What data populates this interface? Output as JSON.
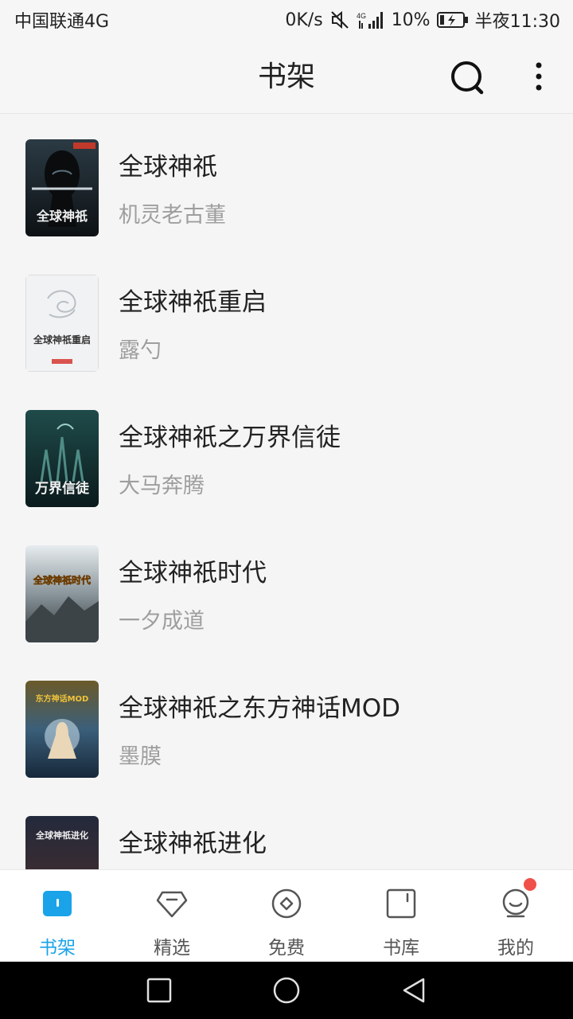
{
  "status_bar": {
    "carrier": "中国联通4G",
    "speed": "0K/s",
    "network": "4G",
    "battery": "10%",
    "time": "半夜11:30",
    "icons": [
      "mute-icon",
      "signal-icon",
      "battery-charging-icon"
    ]
  },
  "app_bar": {
    "title": "书架",
    "search_icon": "search-icon",
    "more_icon": "more-vertical-icon"
  },
  "books": [
    {
      "title": "全球神祇",
      "author": "机灵老古董",
      "cover_text": "全球神祇"
    },
    {
      "title": "全球神祇重启",
      "author": "露勺",
      "cover_text": "全球神祇重启"
    },
    {
      "title": "全球神祇之万界信徒",
      "author": "大马奔腾",
      "cover_text": "万界信徒"
    },
    {
      "title": "全球神祇时代",
      "author": "一夕成道",
      "cover_text": "全球神祇时代"
    },
    {
      "title": "全球神祇之东方神话MOD",
      "author": "墨膜",
      "cover_text": "东方神话MOD"
    },
    {
      "title": "全球神祇进化",
      "author": "",
      "cover_text": "全球神祇进化"
    }
  ],
  "tabs": [
    {
      "label": "书架",
      "icon": "bookshelf-icon",
      "active": true
    },
    {
      "label": "精选",
      "icon": "gem-icon",
      "active": false
    },
    {
      "label": "免费",
      "icon": "coin-icon",
      "active": false
    },
    {
      "label": "书库",
      "icon": "library-icon",
      "active": false
    },
    {
      "label": "我的",
      "icon": "profile-icon",
      "active": false,
      "badge": true
    }
  ],
  "colors": {
    "accent": "#1aa3e8",
    "badge": "#f0504a",
    "author_text": "#9e9e9e"
  },
  "nav_buttons": [
    "recent-apps-icon",
    "home-icon",
    "back-icon"
  ]
}
